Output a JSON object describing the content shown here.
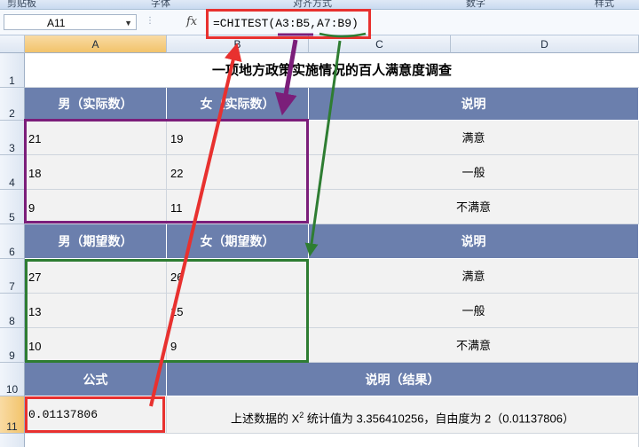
{
  "ribbon": {
    "groups": [
      "剪贴板",
      "字体",
      "对齐方式",
      "数字",
      "样式"
    ]
  },
  "formula_bar": {
    "name_box": "A11",
    "fx_label": "fx",
    "formula": "=CHITEST(A3:B5,A7:B9)"
  },
  "columns": [
    "A",
    "B",
    "C",
    "D"
  ],
  "rows": [
    "1",
    "2",
    "3",
    "4",
    "5",
    "6",
    "7",
    "8",
    "9",
    "10",
    "11"
  ],
  "sheet": {
    "title": "一项地方政策实施情况的百人满意度调查",
    "actual_headers": [
      "男（实际数）",
      "女（实际数）",
      "说明"
    ],
    "actual_rows": [
      [
        "21",
        "19",
        "满意"
      ],
      [
        "18",
        "22",
        "一般"
      ],
      [
        "9",
        "11",
        "不满意"
      ]
    ],
    "expected_headers": [
      "男（期望数）",
      "女（期望数）",
      "说明"
    ],
    "expected_rows": [
      [
        "27",
        "26",
        "满意"
      ],
      [
        "13",
        "15",
        "一般"
      ],
      [
        "10",
        "9",
        "不满意"
      ]
    ],
    "formula_header": "公式",
    "result_header": "说明（结果）",
    "formula_result": "0.01137806",
    "result_text_before": "上述数据的 X",
    "result_superscript": "2",
    "result_text_after": " 统计值为 3.356410256，自由度为 2（0.01137806）"
  },
  "colors": {
    "header_bg": "#6b7fad",
    "data_bg": "#f2f2f2",
    "actual_box": "#7b1e7a",
    "expected_box": "#2e7d32",
    "highlight": "#e8312f"
  }
}
